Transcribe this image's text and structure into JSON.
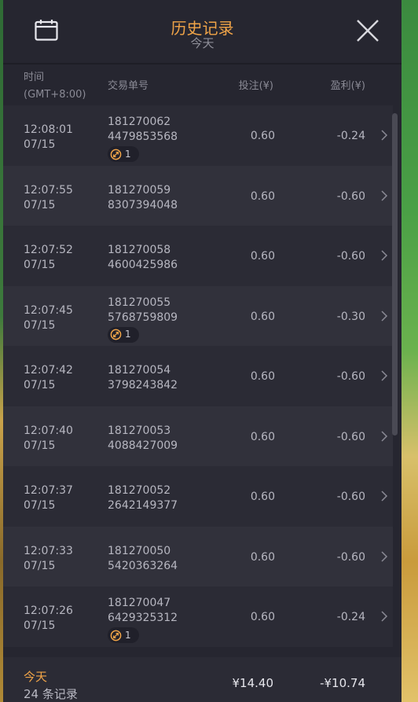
{
  "header": {
    "title": "历史记录",
    "subtitle": "今天"
  },
  "columns": {
    "time": "时间",
    "timezone": "(GMT+8:00)",
    "order": "交易单号",
    "bet": "投注(¥)",
    "profit": "盈利(¥)"
  },
  "rows": [
    {
      "time": "12:08:01",
      "date": "07/15",
      "order1": "181270062",
      "order2": "4479853568",
      "bet": "0.60",
      "profit": "-0.24",
      "badge": "1"
    },
    {
      "time": "12:07:55",
      "date": "07/15",
      "order1": "181270059",
      "order2": "8307394048",
      "bet": "0.60",
      "profit": "-0.60"
    },
    {
      "time": "12:07:52",
      "date": "07/15",
      "order1": "181270058",
      "order2": "4600425986",
      "bet": "0.60",
      "profit": "-0.60"
    },
    {
      "time": "12:07:45",
      "date": "07/15",
      "order1": "181270055",
      "order2": "5768759809",
      "bet": "0.60",
      "profit": "-0.30",
      "badge": "1"
    },
    {
      "time": "12:07:42",
      "date": "07/15",
      "order1": "181270054",
      "order2": "3798243842",
      "bet": "0.60",
      "profit": "-0.60"
    },
    {
      "time": "12:07:40",
      "date": "07/15",
      "order1": "181270053",
      "order2": "4088427009",
      "bet": "0.60",
      "profit": "-0.60"
    },
    {
      "time": "12:07:37",
      "date": "07/15",
      "order1": "181270052",
      "order2": "2642149377",
      "bet": "0.60",
      "profit": "-0.60"
    },
    {
      "time": "12:07:33",
      "date": "07/15",
      "order1": "181270050",
      "order2": "5420363264",
      "bet": "0.60",
      "profit": "-0.60"
    },
    {
      "time": "12:07:26",
      "date": "07/15",
      "order1": "181270047",
      "order2": "6429325312",
      "bet": "0.60",
      "profit": "-0.24",
      "badge": "1"
    }
  ],
  "footer": {
    "label": "今天",
    "count": "24 条记录",
    "total_bet": "¥14.40",
    "total_profit": "-¥10.74"
  },
  "colors": {
    "accent": "#f0a448",
    "panel": "#262630",
    "row_odd": "#2b2b35",
    "row_even": "#31313b"
  },
  "icons": {
    "calendar": "calendar-icon",
    "close": "close-icon",
    "chevron": "chevron-right-icon",
    "badge": "free-spin-icon"
  }
}
